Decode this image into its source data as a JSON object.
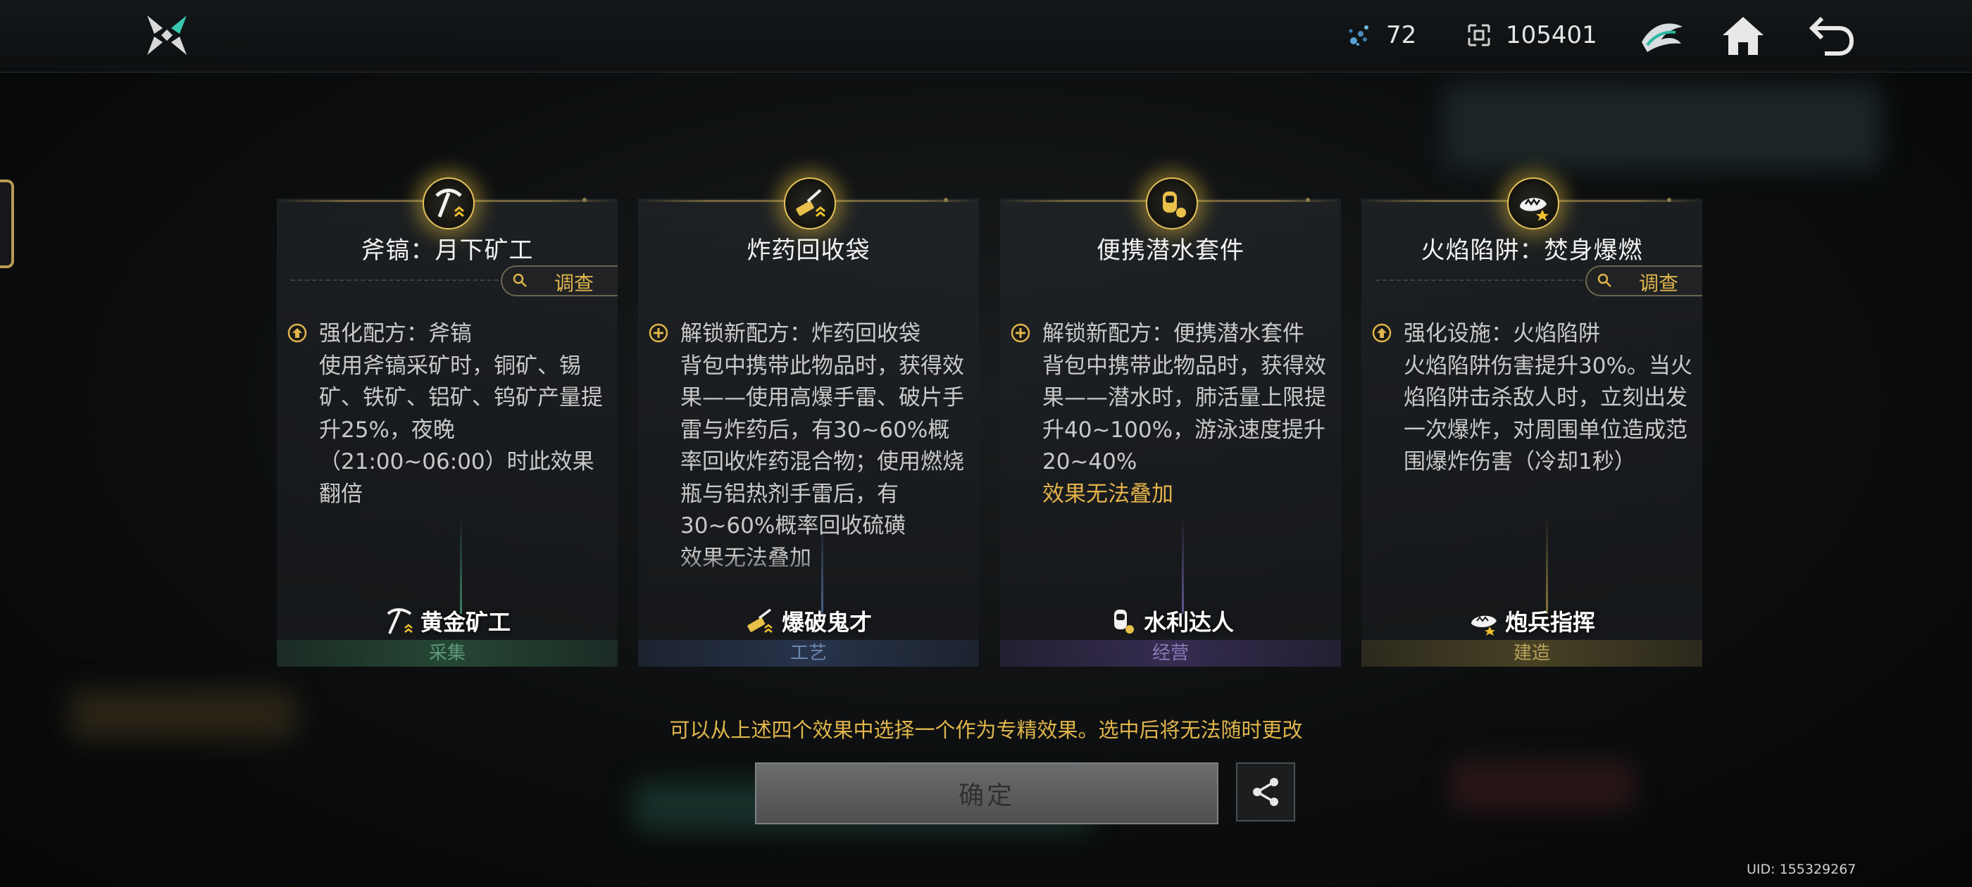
{
  "topbar": {
    "energy_value": "72",
    "coin_value": "105401",
    "icons": [
      "logo-icon",
      "energy-icon",
      "coin-icon",
      "team-emblem-icon",
      "home-icon",
      "back-icon"
    ]
  },
  "cards": [
    {
      "title": "斧镐：月下矿工",
      "survey_label": "调查",
      "has_survey": true,
      "effect_icon": "upgrade-icon",
      "effect_text": "强化配方：斧镐\n使用斧镐采矿时，铜矿、锡矿、铁矿、铝矿、钨矿产量提升25%，夜晚（21:00~06:00）时此效果翻倍",
      "trait_name": "黄金矿工",
      "trait_icon": "pickaxe-icon",
      "category": "采集",
      "category_color": "#5e9a76"
    },
    {
      "title": "炸药回收袋",
      "survey_label": "",
      "has_survey": false,
      "effect_icon": "unlock-icon",
      "effect_text": "解锁新配方：炸药回收袋\n背包中携带此物品时，获得效果——使用高爆手雷、破片手雷与炸药后，有30~60%概率回收炸药混合物；使用燃烧瓶与铝热剂手雷后，有30~60%概率回收硫磺\n效果无法叠加",
      "trait_name": "爆破鬼才",
      "trait_icon": "explosive-icon",
      "category": "工艺",
      "category_color": "#6a86b0"
    },
    {
      "title": "便携潜水套件",
      "survey_label": "",
      "has_survey": false,
      "effect_icon": "unlock-icon",
      "effect_text": "解锁新配方：便携潜水套件\n背包中携带此物品时，获得效果——潜水时，肺活量上限提升40~100%，游泳速度提升20~40%",
      "effect_highlight": "效果无法叠加",
      "trait_name": "水利达人",
      "trait_icon": "diving-icon",
      "category": "经营",
      "category_color": "#8a78b8"
    },
    {
      "title": "火焰陷阱：焚身爆燃",
      "survey_label": "调查",
      "has_survey": true,
      "effect_icon": "upgrade-icon",
      "effect_text": "强化设施：火焰陷阱\n火焰陷阱伤害提升30%。当火焰陷阱击杀敌人时，立刻出发一次爆炸，对周围单位造成范围爆炸伤害（冷却1秒）",
      "trait_name": "炮兵指挥",
      "trait_icon": "artillery-icon",
      "category": "建造",
      "category_color": "#b6a25a"
    }
  ],
  "hint_text": "可以从上述四个效果中选择一个作为专精效果。选中后将无法随时更改",
  "confirm_label": "确定",
  "share_icon": "share-icon",
  "uid_text": "UID: 155329267",
  "colors": {
    "accent_gold": "#e0b54c",
    "confirm_bg": "#5c5e60"
  }
}
